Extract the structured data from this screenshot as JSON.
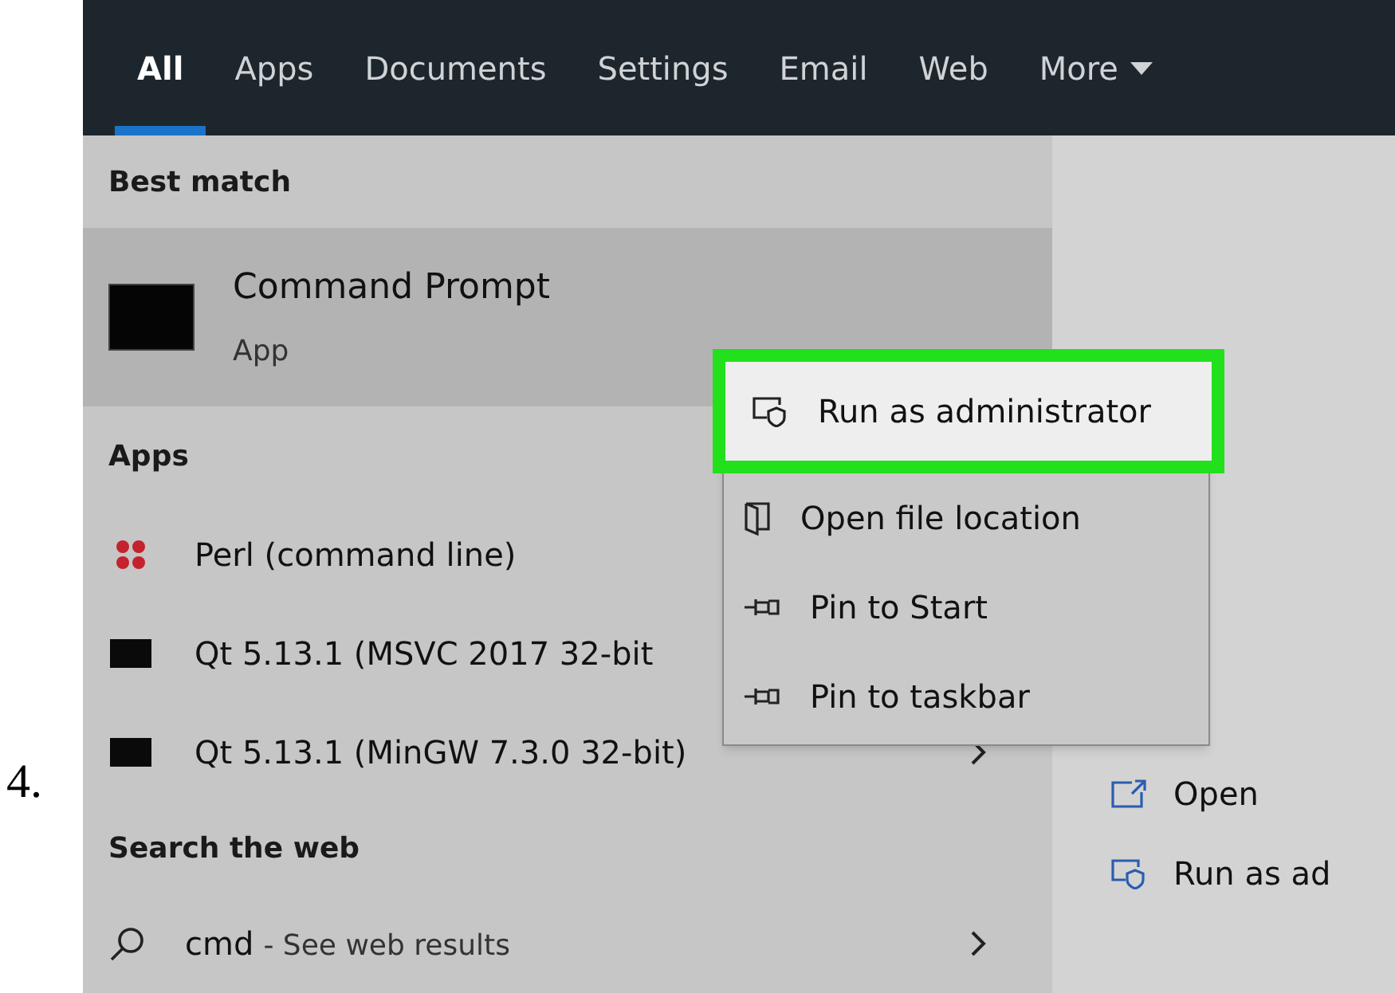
{
  "step_number": "4.",
  "tabs": [
    {
      "label": "All",
      "selected": true
    },
    {
      "label": "Apps",
      "selected": false
    },
    {
      "label": "Documents",
      "selected": false
    },
    {
      "label": "Settings",
      "selected": false
    },
    {
      "label": "Email",
      "selected": false
    },
    {
      "label": "Web",
      "selected": false
    },
    {
      "label": "More",
      "selected": false,
      "dropdown": true
    }
  ],
  "best_match": {
    "heading": "Best match",
    "title": "Command Prompt",
    "subtitle": "App",
    "selected": true
  },
  "apps": {
    "heading": "Apps",
    "items": [
      {
        "label": "Perl (command line)",
        "kind": "perl"
      },
      {
        "label": "Qt 5.13.1 (MSVC 2017 32-bit",
        "kind": "terminal"
      },
      {
        "label": "Qt 5.13.1 (MinGW 7.3.0 32-bit)",
        "kind": "terminal",
        "chevron": true
      }
    ]
  },
  "search_web": {
    "heading": "Search the web",
    "query": "cmd",
    "suffix": "- See web results"
  },
  "context_menu": {
    "items": [
      {
        "label": "Run as administrator",
        "kind": "admin",
        "highlighted": true
      },
      {
        "label": "Open file location",
        "kind": "folder",
        "highlighted": false
      },
      {
        "label": "Pin to Start",
        "kind": "pin",
        "highlighted": false
      },
      {
        "label": "Pin to taskbar",
        "kind": "pin",
        "highlighted": false
      }
    ]
  },
  "details_actions": [
    {
      "label": "Open",
      "kind": "open"
    },
    {
      "label": "Run as ad",
      "kind": "admin"
    }
  ]
}
